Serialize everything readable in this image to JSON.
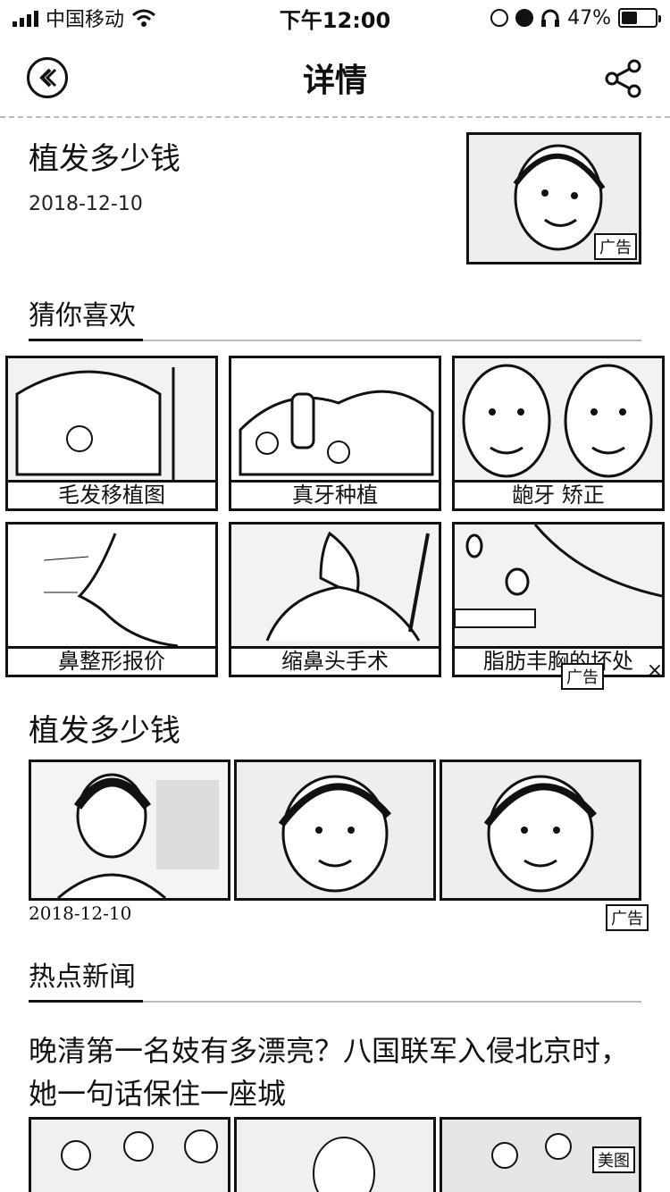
{
  "status_bar": {
    "carrier": "中国移动",
    "time": "下午12:00",
    "battery_percent": "47%",
    "battery_level": 0.47
  },
  "nav": {
    "title": "详情",
    "back_icon": "back-circle-icon",
    "share_icon": "share-icon"
  },
  "article": {
    "title": "植发多少钱",
    "date": "2018-12-10",
    "ad_label": "广告"
  },
  "guess": {
    "heading": "猜你喜欢",
    "items": [
      {
        "label": "毛发移植图"
      },
      {
        "label": "真牙种植"
      },
      {
        "label": "龅牙 矫正"
      },
      {
        "label": "鼻整形报价"
      },
      {
        "label": "缩鼻头手术"
      },
      {
        "label": "脂肪丰胸的坏处"
      }
    ],
    "ad_label": "广告",
    "close_icon": "close-icon"
  },
  "ad_block": {
    "title": "植发多少钱",
    "date": "2018-12-10",
    "ad_label": "广告"
  },
  "news": {
    "heading": "热点新闻",
    "title": "晚清第一名妓有多漂亮？八国联军入侵北京时，她一句话保住一座城",
    "source_label": "美图"
  },
  "colors": {
    "text": "#111111",
    "divider": "#bbbbbb",
    "background": "#ffffff"
  }
}
